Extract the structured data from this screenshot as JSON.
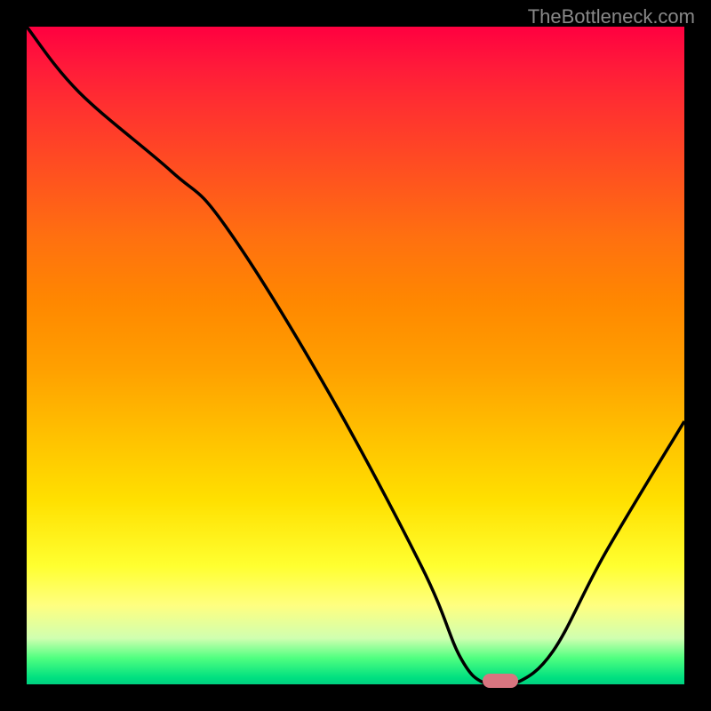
{
  "watermark": "TheBottleneck.com",
  "chart_data": {
    "type": "line",
    "title": "",
    "xlabel": "",
    "ylabel": "",
    "xlim": [
      0,
      100
    ],
    "ylim": [
      0,
      100
    ],
    "background_gradient": {
      "top": "#ff0040",
      "upper_mid": "#ff8800",
      "mid": "#ffe000",
      "lower_mid": "#ffff80",
      "bottom": "#00e080",
      "description": "red (top / high bottleneck) to green (bottom / no bottleneck)"
    },
    "series": [
      {
        "name": "bottleneck-curve",
        "color": "#000000",
        "x": [
          0,
          8,
          22,
          30,
          45,
          60,
          66,
          70,
          74,
          80,
          88,
          100
        ],
        "values": [
          100,
          90,
          78,
          70,
          46,
          18,
          4,
          0,
          0,
          5,
          20,
          40
        ]
      }
    ],
    "marker": {
      "name": "optimal-point",
      "x": 72,
      "y": 0,
      "color": "#d87580"
    },
    "grid": false,
    "legend": null
  }
}
